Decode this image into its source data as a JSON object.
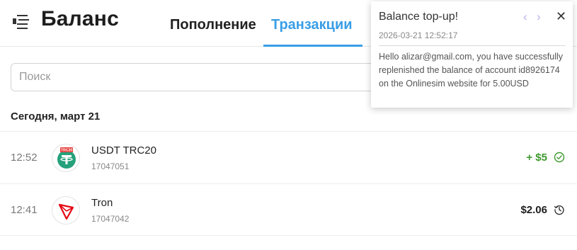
{
  "header": {
    "title": "Баланс",
    "tabs": [
      {
        "label": "Пополнение",
        "active": false
      },
      {
        "label": "Транзакции",
        "active": true
      }
    ],
    "menu_icon": "menu-collapse-icon"
  },
  "search": {
    "placeholder": "Поиск",
    "value": ""
  },
  "transactions": {
    "day_label": "Сегодня, март 21",
    "items": [
      {
        "time": "12:52",
        "name": "USDT TRC20",
        "id": "17047051",
        "amount": "+ $5",
        "coin_icon": "usdt-trc20-icon",
        "coin_badge": "TRC20",
        "status_icon": "check-circle-icon",
        "amount_color": "#3e9a2e"
      },
      {
        "time": "12:41",
        "name": "Tron",
        "id": "17047042",
        "amount": "$2.06",
        "coin_icon": "tron-icon",
        "status_icon": "history-icon",
        "amount_color": "#1d1d1d"
      }
    ]
  },
  "notification": {
    "title": "Balance top-up!",
    "timestamp": "2026-03-21 12:52:17",
    "message": "Hello alizar@gmail.com, you have successfully replenished the balance of account id8926174 on the Onlinesim website for 5.00USD",
    "prev_icon": "chevron-left-icon",
    "next_icon": "chevron-right-icon",
    "close_icon": "close-icon"
  },
  "colors": {
    "accent": "#3a9ee6",
    "positive": "#3e9a2e",
    "usdt": "#26a17b",
    "tron": "#e50914"
  }
}
